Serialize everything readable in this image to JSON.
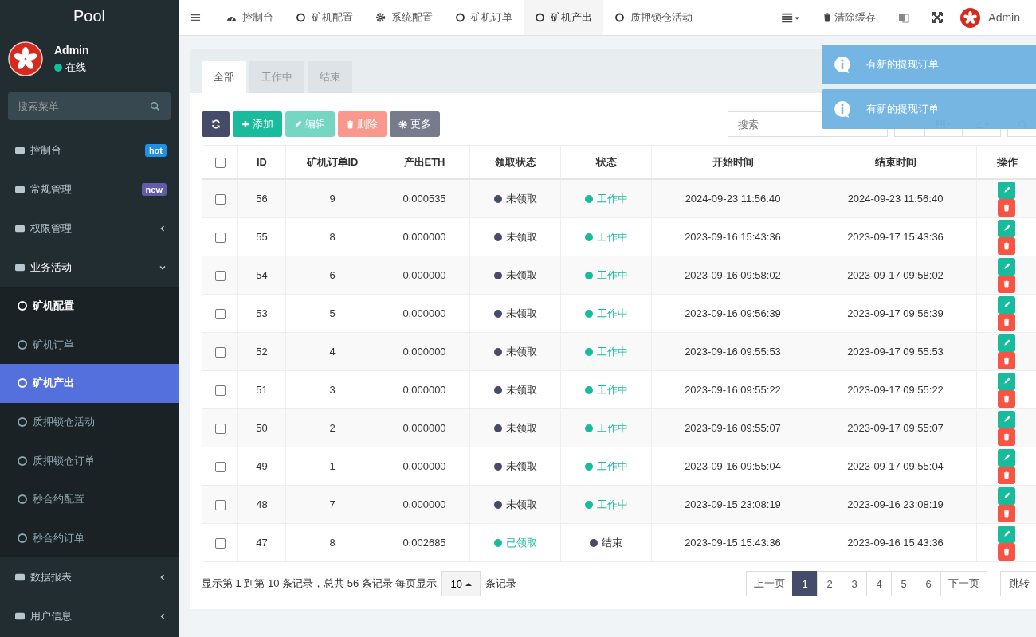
{
  "sidebar": {
    "logo": "Pool",
    "user": {
      "name": "Admin",
      "status": "在线"
    },
    "search": {
      "placeholder": "搜索菜单"
    },
    "items": [
      {
        "label": "控制台",
        "badge": {
          "text": "hot",
          "color": "#1e90e8"
        }
      },
      {
        "label": "常规管理",
        "badge": {
          "text": "new",
          "color": "#605ca8"
        }
      },
      {
        "label": "权限管理",
        "expanded": false
      },
      {
        "label": "业务活动",
        "expanded": true,
        "children": [
          {
            "label": "矿机配置",
            "selected": false,
            "highlighted": true
          },
          {
            "label": "矿机订单",
            "selected": false,
            "highlighted": false
          },
          {
            "label": "矿机产出",
            "selected": true,
            "highlighted": false
          },
          {
            "label": "质押锁仓活动",
            "selected": false,
            "highlighted": false
          },
          {
            "label": "质押锁仓订单",
            "selected": false,
            "highlighted": false
          },
          {
            "label": "秒合约配置",
            "selected": false,
            "highlighted": false
          },
          {
            "label": "秒合约订单",
            "selected": false,
            "highlighted": false
          }
        ]
      },
      {
        "label": "数据报表",
        "expanded": false
      },
      {
        "label": "用户信息",
        "expanded": false
      }
    ]
  },
  "top_nav": {
    "tabs": [
      {
        "label": "控制台",
        "selected": false,
        "kind": "dashboard"
      },
      {
        "label": "矿机配置",
        "selected": false,
        "kind": "circle"
      },
      {
        "label": "系统配置",
        "selected": false,
        "kind": "gear"
      },
      {
        "label": "矿机订单",
        "selected": false,
        "kind": "circle"
      },
      {
        "label": "矿机产出",
        "selected": true,
        "kind": "circle"
      },
      {
        "label": "质押锁仓活动",
        "selected": false,
        "kind": "circle"
      }
    ],
    "clear_cache": "清除缓存",
    "user": "Admin"
  },
  "panel": {
    "tabs": [
      {
        "label": "全部",
        "selected": true
      },
      {
        "label": "工作中",
        "selected": false
      },
      {
        "label": "结束",
        "selected": false
      }
    ],
    "toolbar": [
      {
        "kind": "refresh",
        "disabled": false
      },
      {
        "kind": "add",
        "label": "添加",
        "disabled": false
      },
      {
        "kind": "edit",
        "label": "编辑",
        "disabled": true
      },
      {
        "kind": "delete",
        "label": "删除",
        "disabled": true
      },
      {
        "kind": "more",
        "label": "更多",
        "disabled": false
      }
    ],
    "search": {
      "placeholder": "搜索"
    },
    "table": {
      "select_all_checked": false,
      "columns": [
        "ID",
        "矿机订单ID",
        "产出ETH",
        "领取状态",
        "状态",
        "开始时间",
        "结束时间",
        "操作"
      ],
      "rows": [
        {
          "checked": false,
          "id": "56",
          "order_id": "9",
          "eth": "0.000535",
          "claim": {
            "text": "未领取",
            "claimed": false
          },
          "status": {
            "text": "工作中",
            "working": true
          },
          "start": "2024-09-23 11:56:40",
          "end": "2024-09-23 11:56:40"
        },
        {
          "checked": false,
          "id": "55",
          "order_id": "8",
          "eth": "0.000000",
          "claim": {
            "text": "未领取",
            "claimed": false
          },
          "status": {
            "text": "工作中",
            "working": true
          },
          "start": "2023-09-16 15:43:36",
          "end": "2023-09-17 15:43:36"
        },
        {
          "checked": false,
          "id": "54",
          "order_id": "6",
          "eth": "0.000000",
          "claim": {
            "text": "未领取",
            "claimed": false
          },
          "status": {
            "text": "工作中",
            "working": true
          },
          "start": "2023-09-16 09:58:02",
          "end": "2023-09-17 09:58:02"
        },
        {
          "checked": false,
          "id": "53",
          "order_id": "5",
          "eth": "0.000000",
          "claim": {
            "text": "未领取",
            "claimed": false
          },
          "status": {
            "text": "工作中",
            "working": true
          },
          "start": "2023-09-16 09:56:39",
          "end": "2023-09-17 09:56:39"
        },
        {
          "checked": false,
          "id": "52",
          "order_id": "4",
          "eth": "0.000000",
          "claim": {
            "text": "未领取",
            "claimed": false
          },
          "status": {
            "text": "工作中",
            "working": true
          },
          "start": "2023-09-16 09:55:53",
          "end": "2023-09-17 09:55:53"
        },
        {
          "checked": false,
          "id": "51",
          "order_id": "3",
          "eth": "0.000000",
          "claim": {
            "text": "未领取",
            "claimed": false
          },
          "status": {
            "text": "工作中",
            "working": true
          },
          "start": "2023-09-16 09:55:22",
          "end": "2023-09-17 09:55:22"
        },
        {
          "checked": false,
          "id": "50",
          "order_id": "2",
          "eth": "0.000000",
          "claim": {
            "text": "未领取",
            "claimed": false
          },
          "status": {
            "text": "工作中",
            "working": true
          },
          "start": "2023-09-16 09:55:07",
          "end": "2023-09-17 09:55:07"
        },
        {
          "checked": false,
          "id": "49",
          "order_id": "1",
          "eth": "0.000000",
          "claim": {
            "text": "未领取",
            "claimed": false
          },
          "status": {
            "text": "工作中",
            "working": true
          },
          "start": "2023-09-16 09:55:04",
          "end": "2023-09-17 09:55:04"
        },
        {
          "checked": false,
          "id": "48",
          "order_id": "7",
          "eth": "0.000000",
          "claim": {
            "text": "未领取",
            "claimed": false
          },
          "status": {
            "text": "工作中",
            "working": true
          },
          "start": "2023-09-15 23:08:19",
          "end": "2023-09-16 23:08:19"
        },
        {
          "checked": false,
          "id": "47",
          "order_id": "8",
          "eth": "0.002685",
          "claim": {
            "text": "已领取",
            "claimed": true
          },
          "status": {
            "text": "结束",
            "working": false
          },
          "start": "2023-09-15 15:43:36",
          "end": "2023-09-16 15:43:36"
        }
      ]
    },
    "footer": {
      "summary": "显示第 1 到第 10 条记录，总共 56 条记录 每页显示",
      "page_size": "10",
      "after": "条记录",
      "pages": [
        {
          "label": "上一页",
          "selected": false
        },
        {
          "label": "1",
          "selected": true
        },
        {
          "label": "2",
          "selected": false
        },
        {
          "label": "3",
          "selected": false
        },
        {
          "label": "4",
          "selected": false
        },
        {
          "label": "5",
          "selected": false
        },
        {
          "label": "6",
          "selected": false
        },
        {
          "label": "下一页",
          "selected": false
        }
      ],
      "jump": "跳转"
    }
  },
  "toasts": [
    "有新的提现订单",
    "有新的提现订单"
  ]
}
